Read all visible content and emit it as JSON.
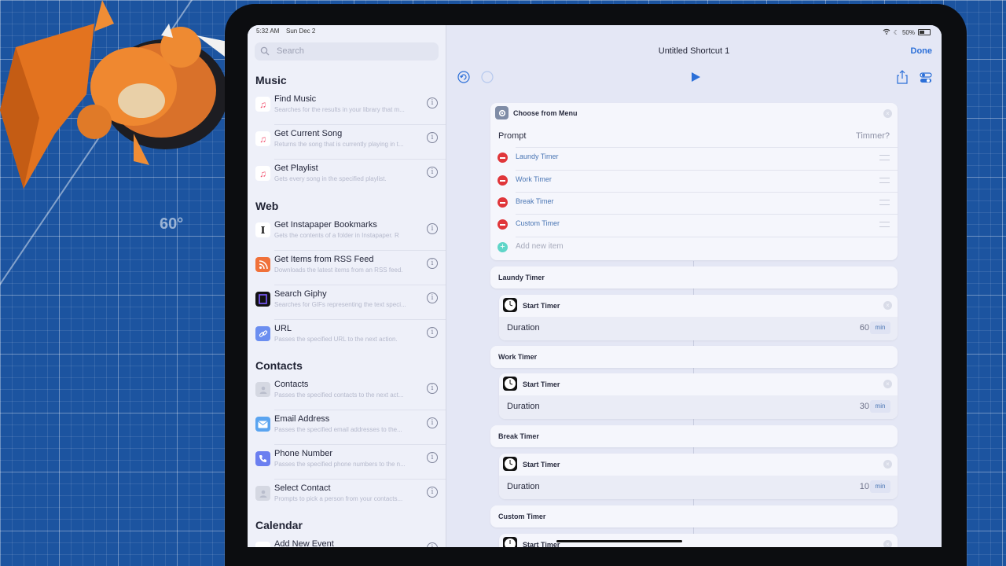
{
  "status": {
    "time": "5:32 AM",
    "date": "Sun Dec 2",
    "battery": "50%"
  },
  "background": {
    "angle_label": "60°"
  },
  "sidebar": {
    "search_placeholder": "Search",
    "sections": [
      {
        "title": "Music",
        "items": [
          {
            "title": "Find Music",
            "desc": "Searches for the results in your library that m...",
            "icon": "music-note-icon",
            "color": "#ffffff"
          },
          {
            "title": "Get Current Song",
            "desc": "Returns the song that is currently playing in t...",
            "icon": "music-note-icon",
            "color": "#ffffff"
          },
          {
            "title": "Get Playlist",
            "desc": "Gets every song in the specified playlist.",
            "icon": "music-note-icon",
            "color": "#ffffff"
          }
        ]
      },
      {
        "title": "Web",
        "items": [
          {
            "title": "Get Instapaper Bookmarks",
            "desc": "Gets the contents of a folder in Instapaper. R",
            "icon": "instapaper-icon",
            "color": "#ffffff"
          },
          {
            "title": "Get Items from RSS Feed",
            "desc": "Downloads the latest items from an RSS feed.",
            "icon": "rss-icon",
            "color": "#f0713a"
          },
          {
            "title": "Search Giphy",
            "desc": "Searches for GIFs representing the text speci...",
            "icon": "giphy-icon",
            "color": "#121212"
          },
          {
            "title": "URL",
            "desc": "Passes the specified URL to the next action.",
            "icon": "link-icon",
            "color": "#6b8ef0"
          }
        ]
      },
      {
        "title": "Contacts",
        "items": [
          {
            "title": "Contacts",
            "desc": "Passes the specified contacts to the next act...",
            "icon": "contacts-icon",
            "color": "#d5d8e2"
          },
          {
            "title": "Email Address",
            "desc": "Passes the specified email addresses to the...",
            "icon": "mail-icon",
            "color": "#5aa4f0"
          },
          {
            "title": "Phone Number",
            "desc": "Passes the specified phone numbers to the n...",
            "icon": "phone-icon",
            "color": "#6b7ff0"
          },
          {
            "title": "Select Contact",
            "desc": "Prompts to pick a person from your contacts...",
            "icon": "contacts-icon",
            "color": "#d5d8e2"
          }
        ]
      },
      {
        "title": "Calendar",
        "items": [
          {
            "title": "Add New Event",
            "desc": "",
            "icon": "calendar-icon",
            "color": "#ffffff"
          }
        ]
      }
    ]
  },
  "editor": {
    "title": "Untitled Shortcut 1",
    "done_label": "Done",
    "menu": {
      "title": "Choose from Menu",
      "prompt_label": "Prompt",
      "prompt_value": "Timmer?",
      "items": [
        "Laundy Timer",
        "Work Timer",
        "Break Timer",
        "Custom Timer"
      ],
      "add_label": "Add new item"
    },
    "cases": [
      {
        "label": "Laundy Timer",
        "action": "Start Timer",
        "duration_label": "Duration",
        "value": "60",
        "unit": "min"
      },
      {
        "label": "Work Timer",
        "action": "Start Timer",
        "duration_label": "Duration",
        "value": "30",
        "unit": "min"
      },
      {
        "label": "Break Timer",
        "action": "Start Timer",
        "duration_label": "Duration",
        "value": "10",
        "unit": "min"
      },
      {
        "label": "Custom Timer",
        "action": "Start Timer",
        "duration_label": "",
        "value": "",
        "unit": ""
      }
    ]
  }
}
